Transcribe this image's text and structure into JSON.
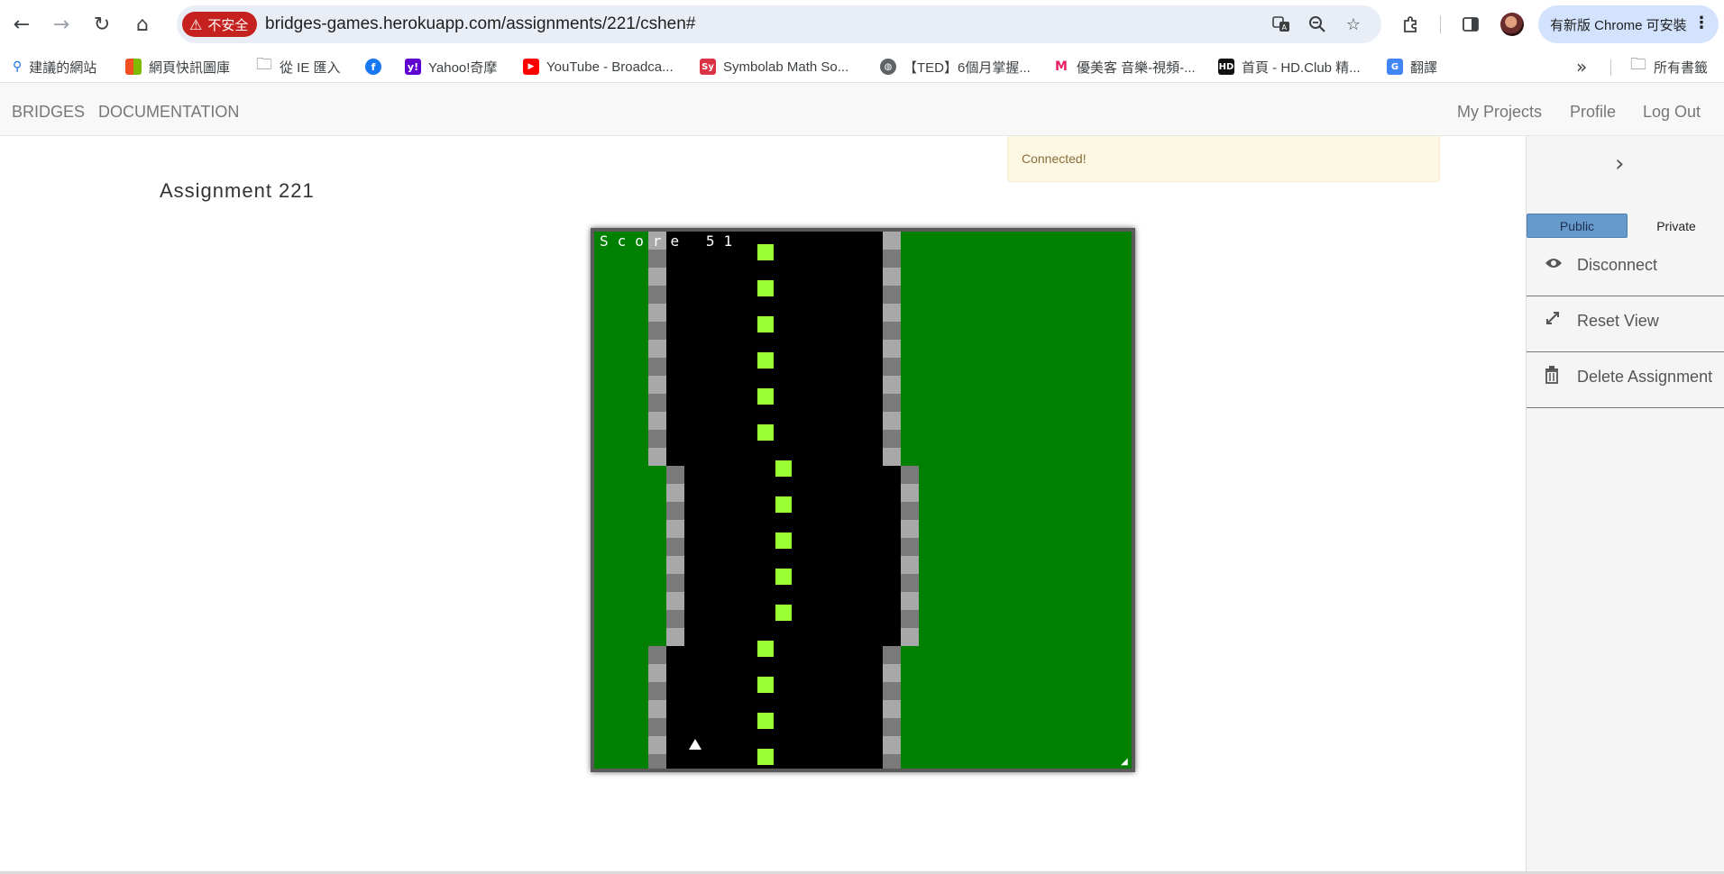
{
  "browser": {
    "back_icon": "back-arrow-icon",
    "forward_icon": "forward-arrow-icon",
    "reload_icon": "reload-icon",
    "home_icon": "home-icon",
    "security_label": "不安全",
    "url": "bridges-games.herokuapp.com/assignments/221/cshen#",
    "update_label": "有新版 Chrome 可安裝"
  },
  "bookmarks": [
    {
      "label": "建議的網站",
      "color": "#1a73e8"
    },
    {
      "label": "網頁快訊圖庫",
      "color": "#f25022"
    },
    {
      "label": "從 IE 匯入",
      "color": "#5f6368"
    },
    {
      "label": "",
      "color": "#1877f2"
    },
    {
      "label": "Yahoo!奇摩",
      "color": "#6001d2"
    },
    {
      "label": "YouTube - Broadca...",
      "color": "#ff0000"
    },
    {
      "label": "Symbolab Math So...",
      "color": "#db3246"
    },
    {
      "label": "【TED】6個月掌握...",
      "color": "#5f6368"
    },
    {
      "label": "優美客 音樂-視頻-...",
      "color": "#e91e63"
    },
    {
      "label": "首頁 - HD.Club 精...",
      "color": "#111111"
    },
    {
      "label": "翻譯",
      "color": "#4285f4"
    }
  ],
  "bookmark_icon_text": {
    "symbolab": "Sy",
    "hdclub": "HD",
    "yahoo": "y!"
  },
  "all_bookmarks_label": "所有書籤",
  "site_nav": {
    "brand": "BRIDGES",
    "documentation": "DOCUMENTATION",
    "my_projects": "My Projects",
    "profile": "Profile",
    "log_out": "Log Out"
  },
  "alert": "Connected!",
  "assignment_title": "Assignment 221",
  "game": {
    "score_label": "Score",
    "score_value": "51",
    "colors": {
      "grass": "#008000",
      "road": "#000000",
      "lane_marker": "#99ff33",
      "curb_light": "#a8a8a8",
      "curb_dark": "#7a7a7a",
      "player": "#ffffff"
    }
  },
  "sidebar": {
    "collapse_icon": "chevron-right-icon",
    "visibility": {
      "public": "Public",
      "private": "Private",
      "selected": "Public"
    },
    "actions": [
      {
        "label": "Disconnect",
        "icon": "eye-icon"
      },
      {
        "label": "Reset View",
        "icon": "expand-icon"
      },
      {
        "label": "Delete Assignment",
        "icon": "trash-icon"
      }
    ]
  }
}
